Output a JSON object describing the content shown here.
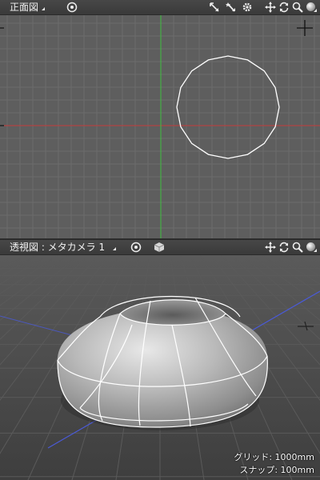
{
  "colors": {
    "front_background": "#5e5e5e",
    "grid_line": "#6a6a6a",
    "x_axis": "#c43c3c",
    "y_axis": "#3fbf3f",
    "toolbar_background": "#404040",
    "wireframe": "#ffffff",
    "perspective_floor": "#4a4a4a",
    "blue_axis": "#4a5ad8"
  },
  "front_view": {
    "label": "正面図",
    "icons": [
      "target-icon",
      "select-arrow-icon",
      "magic-select-icon",
      "gear-icon",
      "move-icon",
      "rotate-icon",
      "zoom-icon",
      "shading-sphere-icon"
    ]
  },
  "perspective_view": {
    "label": "透視図 : メタカメラ 1",
    "icons": [
      "target-icon",
      "cube-icon",
      "move-icon",
      "rotate-icon",
      "zoom-icon",
      "shading-sphere-icon"
    ],
    "status": {
      "grid": "グリッド: 1000mm",
      "snap": "スナップ: 100mm"
    }
  }
}
